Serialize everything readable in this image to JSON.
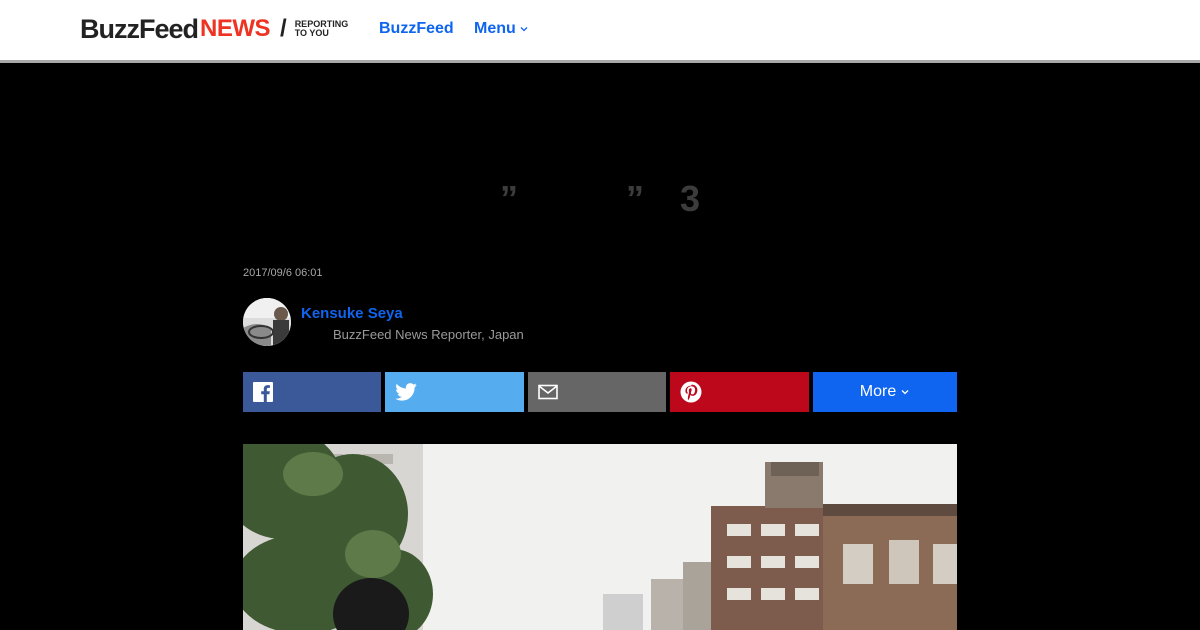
{
  "header": {
    "logo_buzzfeed": "BuzzFeed",
    "logo_news": "NEWS",
    "logo_slash": "/",
    "logo_tagline_line1": "REPORTING",
    "logo_tagline_line2": "TO YOU",
    "nav_buzzfeed": "BuzzFeed",
    "nav_menu": "Menu"
  },
  "article": {
    "headline": "”　　　”　3",
    "date": "2017/09/6 06:01",
    "author_name": "Kensuke Seya",
    "author_role": "BuzzFeed News Reporter, Japan"
  },
  "share": {
    "more_label": "More"
  },
  "colors": {
    "accent": "#0f65ef",
    "facebook": "#3b5998",
    "twitter": "#55acee",
    "email": "#666666",
    "pinterest": "#bd081c"
  }
}
